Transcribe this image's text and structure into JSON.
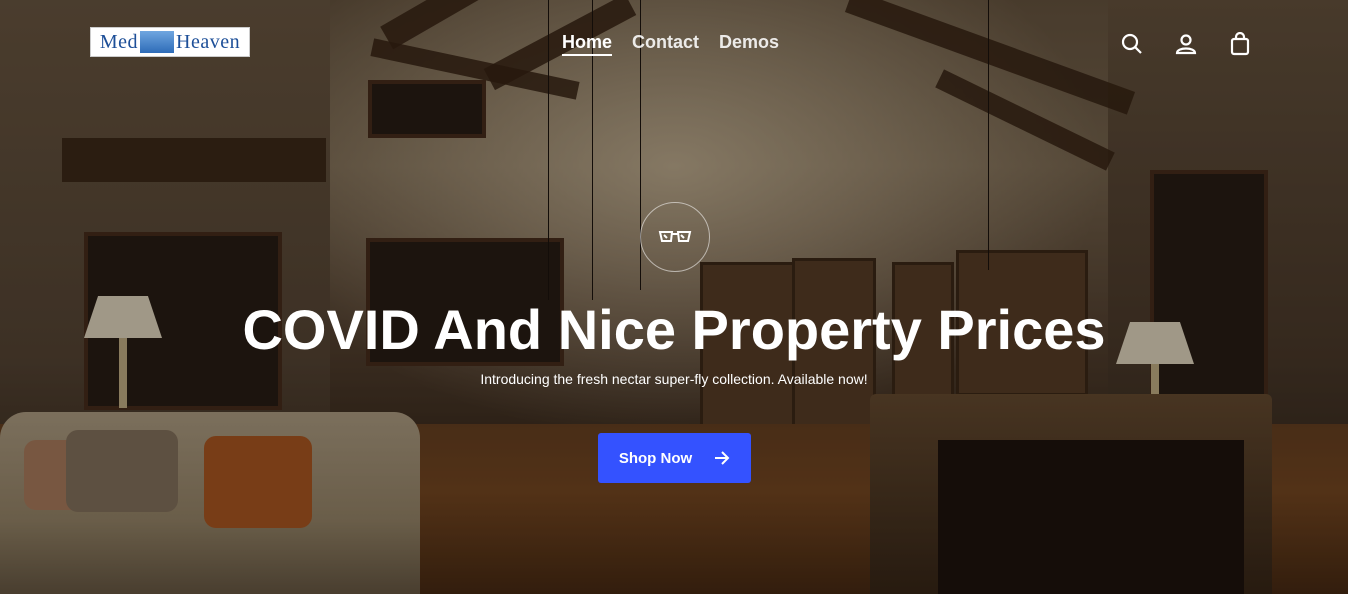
{
  "brand": {
    "logo_text_left": "Med",
    "logo_text_right": "Heaven"
  },
  "nav": {
    "items": [
      {
        "label": "Home"
      },
      {
        "label": "Contact"
      },
      {
        "label": "Demos"
      }
    ]
  },
  "header_icons": [
    "search-icon",
    "user-account-icon",
    "shopping-bag-icon"
  ],
  "hero": {
    "badge_icon": "sunglasses-icon",
    "title": "COVID And Nice Property Prices",
    "subtitle": "Introducing the fresh nectar super-fly collection. Available now!",
    "cta_label": "Shop Now",
    "cta_icon": "arrow-right-icon"
  },
  "colors": {
    "accent": "#3452ff",
    "text": "#ffffff"
  }
}
